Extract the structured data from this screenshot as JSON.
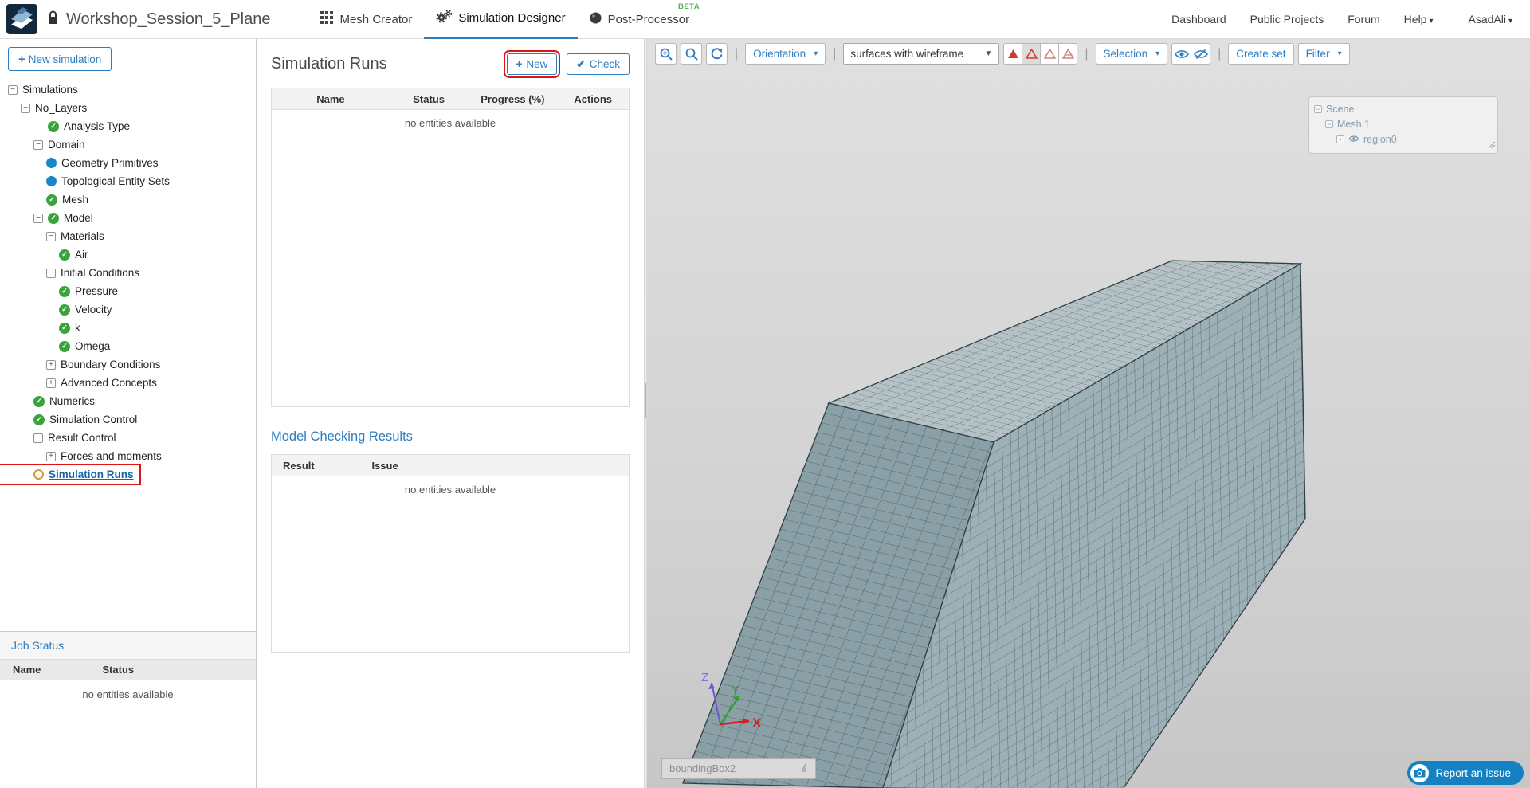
{
  "header": {
    "project_title": "Workshop_Session_5_Plane",
    "tabs": [
      {
        "label": "Mesh Creator"
      },
      {
        "label": "Simulation Designer",
        "active": true
      },
      {
        "label": "Post-Processor",
        "badge": "BETA"
      }
    ],
    "nav": [
      "Dashboard",
      "Public Projects",
      "Forum"
    ],
    "help_label": "Help",
    "user_label": "AsadAli"
  },
  "sidebar": {
    "new_simulation_label": "New simulation",
    "tree": [
      {
        "label": "Simulations",
        "depth": 0,
        "icons": [
          "collapse"
        ]
      },
      {
        "label": "No_Layers",
        "depth": 1,
        "icons": [
          "collapse"
        ]
      },
      {
        "label": "Analysis Type",
        "depth": 2,
        "icons": [
          "blank",
          "check"
        ]
      },
      {
        "label": "Domain",
        "depth": 2,
        "icons": [
          "collapse"
        ]
      },
      {
        "label": "Geometry Primitives",
        "depth": 3,
        "icons": [
          "dot"
        ]
      },
      {
        "label": "Topological Entity Sets",
        "depth": 3,
        "icons": [
          "dot"
        ]
      },
      {
        "label": "Mesh",
        "depth": 3,
        "icons": [
          "check"
        ]
      },
      {
        "label": "Model",
        "depth": 2,
        "icons": [
          "collapse",
          "check"
        ]
      },
      {
        "label": "Materials",
        "depth": 3,
        "icons": [
          "collapse"
        ]
      },
      {
        "label": "Air",
        "depth": 4,
        "icons": [
          "check"
        ]
      },
      {
        "label": "Initial Conditions",
        "depth": 3,
        "icons": [
          "collapse"
        ]
      },
      {
        "label": "Pressure",
        "depth": 4,
        "icons": [
          "check"
        ]
      },
      {
        "label": "Velocity",
        "depth": 4,
        "icons": [
          "check"
        ]
      },
      {
        "label": "k",
        "depth": 4,
        "icons": [
          "check"
        ]
      },
      {
        "label": "Omega",
        "depth": 4,
        "icons": [
          "check"
        ]
      },
      {
        "label": "Boundary Conditions",
        "depth": 3,
        "icons": [
          "expand"
        ]
      },
      {
        "label": "Advanced Concepts",
        "depth": 3,
        "icons": [
          "expand"
        ]
      },
      {
        "label": "Numerics",
        "depth": 2,
        "icons": [
          "check"
        ]
      },
      {
        "label": "Simulation Control",
        "depth": 2,
        "icons": [
          "check"
        ]
      },
      {
        "label": "Result Control",
        "depth": 2,
        "icons": [
          "collapse"
        ]
      },
      {
        "label": "Forces and moments",
        "depth": 3,
        "icons": [
          "expand"
        ]
      },
      {
        "label": "Simulation Runs",
        "depth": 2,
        "icons": [
          "circle"
        ],
        "highlighted": true,
        "link": true
      }
    ],
    "job_status": {
      "title": "Job Status",
      "columns": [
        "Name",
        "Status"
      ],
      "empty_text": "no entities available"
    }
  },
  "runs_panel": {
    "title": "Simulation Runs",
    "new_button": "New",
    "check_button": "Check",
    "runs_table": {
      "columns": [
        "Name",
        "Status",
        "Progress (%)",
        "Actions"
      ],
      "empty_text": "no entities available"
    },
    "model_checking": {
      "title": "Model Checking Results",
      "columns": [
        "Result",
        "Issue"
      ],
      "empty_text": "no entities available"
    }
  },
  "viewport": {
    "toolbar": {
      "orientation_label": "Orientation",
      "render_mode_value": "surfaces with wireframe",
      "selection_label": "Selection",
      "create_set_label": "Create set",
      "filter_label": "Filter"
    },
    "scene_tree": [
      {
        "label": "Scene"
      },
      {
        "label": "Mesh 1"
      },
      {
        "label": "region0"
      }
    ],
    "bounding_box_value": "boundingBox2",
    "report_issue_label": "Report an issue",
    "axes": {
      "x": "X",
      "y": "Y",
      "z": "Z"
    }
  },
  "colors": {
    "accent_blue": "#2d7dc1",
    "highlight_red": "#e01414",
    "check_green": "#3aa33a",
    "beta_green": "#56b04c",
    "mesh_top": "#b4c2c6",
    "mesh_front": "#9cb0b6",
    "mesh_side": "#8b9fa6",
    "mesh_line": "#42565d"
  }
}
